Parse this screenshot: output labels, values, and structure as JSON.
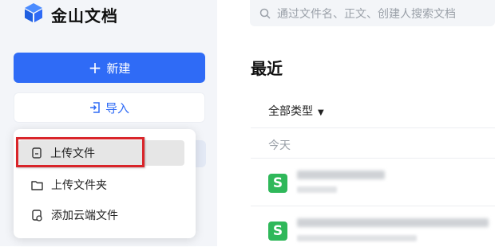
{
  "app": {
    "name": "金山文档"
  },
  "sidebar": {
    "new_label": "新建",
    "import_label": "导入"
  },
  "import_menu": {
    "items": [
      {
        "label": "上传文件",
        "icon": "file-icon"
      },
      {
        "label": "上传文件夹",
        "icon": "folder-icon"
      },
      {
        "label": "添加云端文件",
        "icon": "cloud-file-icon"
      }
    ]
  },
  "search": {
    "placeholder": "通过文件名、正文、创建人搜索文档"
  },
  "main": {
    "section_title": "最近",
    "filter_label": "全部类型",
    "group_label": "今天",
    "file_icon_letter": "S"
  },
  "colors": {
    "primary": "#2f6bf6",
    "highlight": "#d9252a",
    "sheet_icon": "#2fb85a"
  }
}
